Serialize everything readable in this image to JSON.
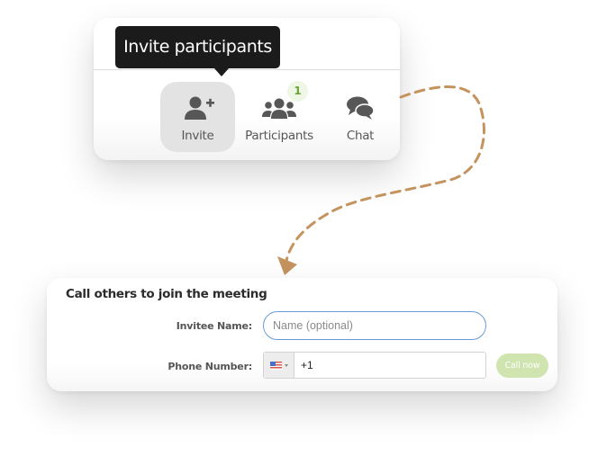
{
  "toolbar": {
    "tooltip": "Invite participants",
    "buttons": [
      {
        "id": "invite",
        "label": "Invite",
        "icon": "user-plus-icon",
        "active": true
      },
      {
        "id": "participants",
        "label": "Participants",
        "icon": "users-icon",
        "badge": "1"
      },
      {
        "id": "chat",
        "label": "Chat",
        "icon": "chat-bubbles-icon"
      }
    ]
  },
  "form": {
    "title": "Call others to join the meeting",
    "invitee_label": "Invitee Name:",
    "invitee_value": "",
    "invitee_placeholder": "Name (optional)",
    "phone_label": "Phone Number:",
    "country": "US",
    "country_icon": "us-flag-icon",
    "phone_value": "+1",
    "call_button": "Call now"
  },
  "colors": {
    "accent_arrow": "#c4935e",
    "badge_text": "#6aa43a",
    "call_button_bg": "#cfe4ae",
    "input_focus_border": "#6a9bd8",
    "tooltip_bg": "#1b1b1b"
  }
}
